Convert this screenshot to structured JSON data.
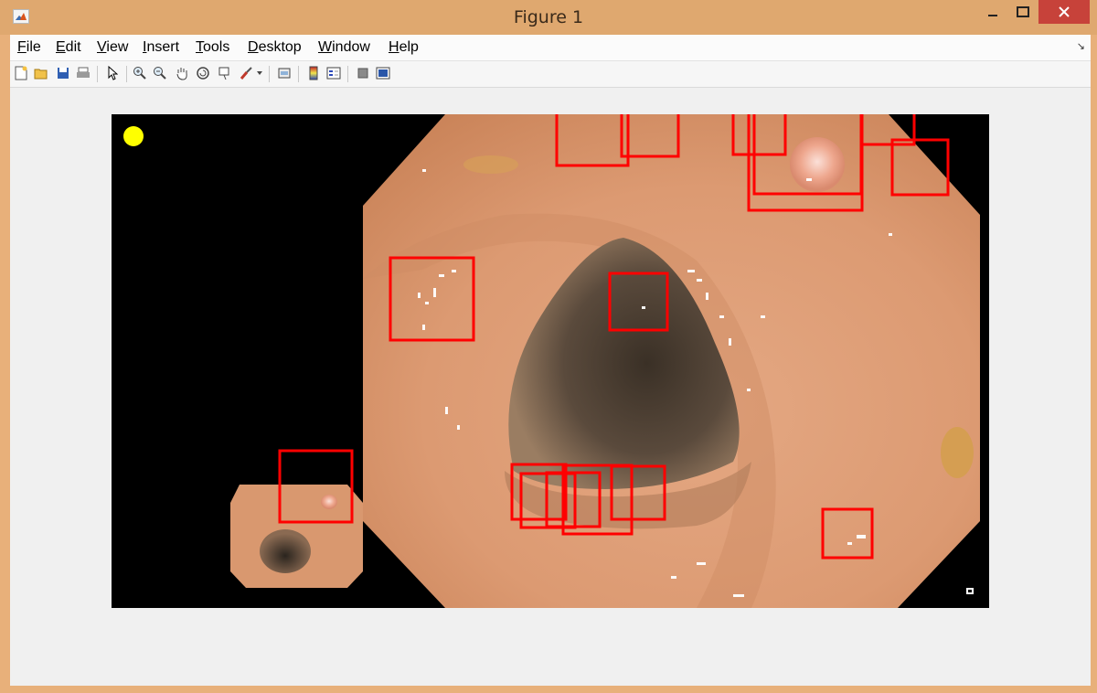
{
  "window": {
    "title": "Figure 1"
  },
  "menu": {
    "file": "File",
    "edit": "Edit",
    "view": "View",
    "insert": "Insert",
    "tools": "Tools",
    "desktop": "Desktop",
    "window": "Window",
    "help": "Help"
  },
  "toolbar": {
    "buttons": [
      "new-figure",
      "open-file",
      "save-figure",
      "print-figure",
      "edit-plot",
      "zoom-in",
      "zoom-out",
      "pan",
      "rotate-3d",
      "data-cursor",
      "brush",
      "link-plot",
      "insert-colorbar",
      "insert-legend",
      "hide-plot-tools",
      "show-plot-tools"
    ]
  },
  "colors": {
    "box": "#ff0000",
    "marker": "#ffff00",
    "background": "#000000"
  }
}
